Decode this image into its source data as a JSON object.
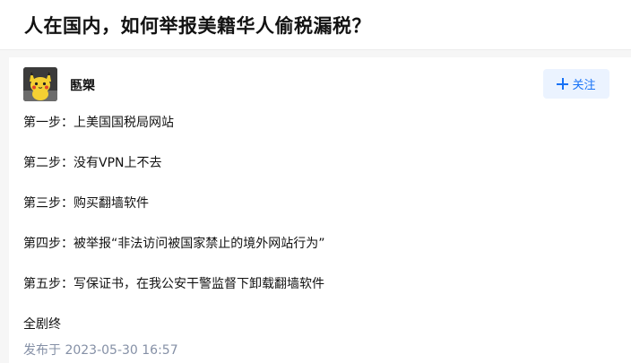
{
  "question": {
    "title": "人在国内，如何举报美籍华人偷税漏税？"
  },
  "answer": {
    "author_name": "匦槊",
    "follow_button": {
      "label": "关注",
      "icon": "plus-icon",
      "color": "#1772f6",
      "background": "#ebf3ff"
    },
    "paragraphs": [
      "第一步：上美国国税局网站",
      "第二步：没有VPN上不去",
      "第三步：购买翻墙软件",
      "第四步：被举报“非法访问被国家禁止的境外网站行为”",
      "第五步：写保证书，在我公安干警监督下卸载翻墙软件",
      "全剧终"
    ],
    "published": "发布于 2023-05-30 16:57",
    "avatar_icon": "pikachu-avatar"
  }
}
